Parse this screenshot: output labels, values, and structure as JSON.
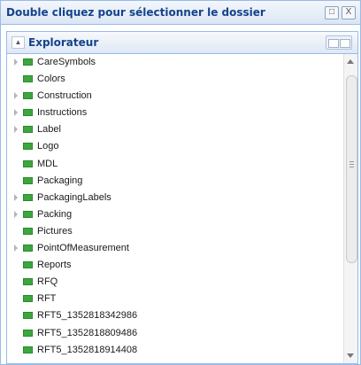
{
  "window": {
    "title": "Double cliquez pour sélectionner le dossier",
    "restore_glyph": "□",
    "close_glyph": "X"
  },
  "panel": {
    "title": "Explorateur",
    "collapse_glyph": "▲"
  },
  "tree": {
    "items": [
      {
        "label": "CareSymbols",
        "expandable": true
      },
      {
        "label": "Colors",
        "expandable": false
      },
      {
        "label": "Construction",
        "expandable": true
      },
      {
        "label": "Instructions",
        "expandable": true
      },
      {
        "label": "Label",
        "expandable": true
      },
      {
        "label": "Logo",
        "expandable": false
      },
      {
        "label": "MDL",
        "expandable": false
      },
      {
        "label": "Packaging",
        "expandable": false
      },
      {
        "label": "PackagingLabels",
        "expandable": true
      },
      {
        "label": "Packing",
        "expandable": true
      },
      {
        "label": "Pictures",
        "expandable": false
      },
      {
        "label": "PointOfMeasurement",
        "expandable": true
      },
      {
        "label": "Reports",
        "expandable": false
      },
      {
        "label": "RFQ",
        "expandable": false
      },
      {
        "label": "RFT",
        "expandable": false
      },
      {
        "label": "RFT5_1352818342986",
        "expandable": false
      },
      {
        "label": "RFT5_1352818809486",
        "expandable": false
      },
      {
        "label": "RFT5_1352818914408",
        "expandable": false
      }
    ]
  },
  "colors": {
    "title_text": "#15428b",
    "border": "#99bbe8",
    "node_icon": "#3ea63e"
  }
}
